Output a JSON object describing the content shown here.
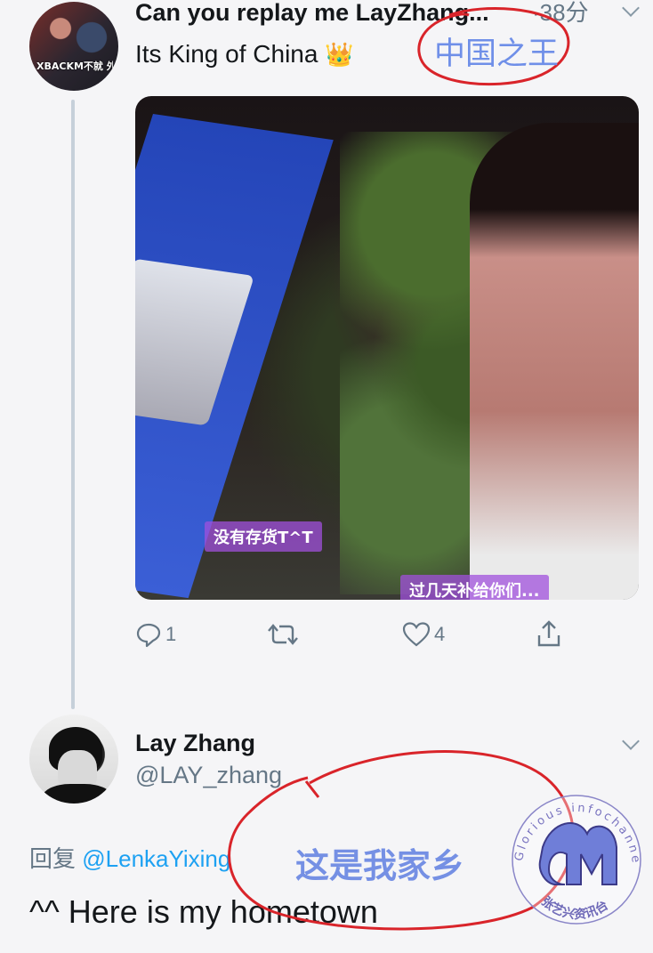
{
  "tweet1": {
    "avatar_caption": "XBACKM不就 外国",
    "name": "Can you replay me LayZhang...",
    "time": "·38分",
    "text": "Its King of China",
    "emoji": "👑",
    "media": {
      "subtitle_1": "没有存货T^T",
      "subtitle_2": "过几天补给你们..."
    },
    "actions": {
      "reply_count": "1",
      "retweet_count": "",
      "like_count": "4"
    }
  },
  "annotation1": "中国之王",
  "tweet2": {
    "name": "Lay Zhang",
    "handle": "@LAY_zhang",
    "reply_prefix": "回复",
    "reply_to": "@LenkaYixing",
    "text": "^^ Here is my hometown"
  },
  "annotation2": "这是我家乡",
  "watermark": {
    "arc_text": "Glorious infochannel",
    "bottom_text": "张艺兴资讯台"
  },
  "colors": {
    "background": "#f5f5f7",
    "link": "#1da1f2",
    "secondary_text": "#657786",
    "annotation_red": "#d9242a",
    "annotation_text": "#7590e4"
  }
}
